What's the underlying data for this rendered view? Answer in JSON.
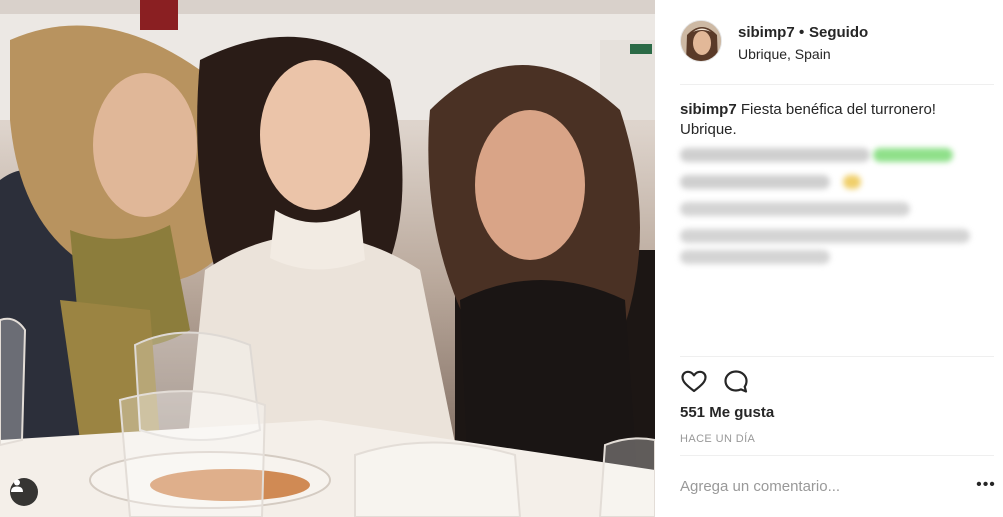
{
  "post": {
    "username": "sibimp7",
    "separator": "•",
    "follow_state": "Seguido",
    "location": "Ubrique, Spain",
    "caption_user": "sibimp7",
    "caption_text": "Fiesta benéfica del turronero! Ubrique.",
    "likes": "551 Me gusta",
    "time": "HACE UN DÍA",
    "comment_placeholder": "Agrega un comentario...",
    "more_label": "•••"
  },
  "icons": {
    "like": "heart-icon",
    "comment": "comment-icon",
    "more": "more-options-icon",
    "user_tag": "user-tag-icon"
  },
  "colors": {
    "text": "#262626",
    "muted": "#999999",
    "divider": "#efefef"
  }
}
